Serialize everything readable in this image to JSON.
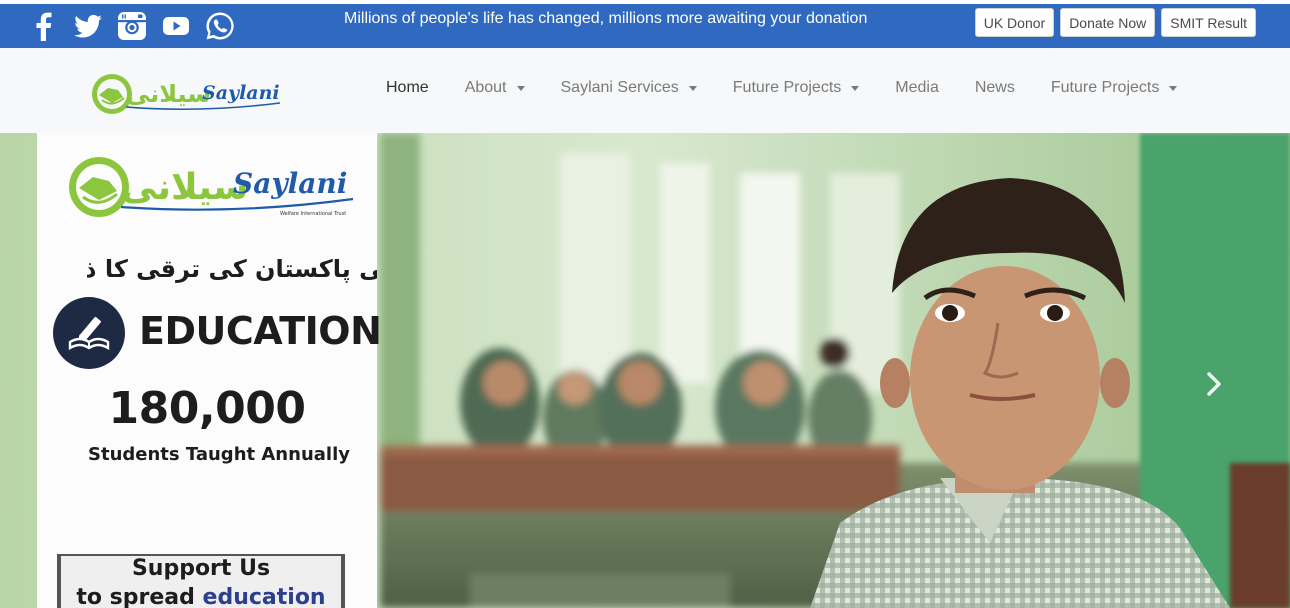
{
  "topbar": {
    "social": [
      "facebook-icon",
      "twitter-icon",
      "instagram-icon",
      "youtube-icon",
      "whatsapp-icon"
    ],
    "tagline": "Millions of people's life has changed, millions more awaiting your donation",
    "buttons": {
      "uk_donor": "UK Donor",
      "donate_now": "Donate Now",
      "smit_result": "SMIT Result"
    },
    "bg_color": "#2f6ac0"
  },
  "navbar": {
    "logo": {
      "urdu": "سیلانی",
      "latin": "Saylani"
    },
    "items": [
      {
        "label": "Home",
        "dropdown": false,
        "active": true
      },
      {
        "label": "About",
        "dropdown": true
      },
      {
        "label": "Saylani Services",
        "dropdown": true
      },
      {
        "label": "Future Projects",
        "dropdown": true
      },
      {
        "label": "Media",
        "dropdown": false
      },
      {
        "label": "News",
        "dropdown": false
      },
      {
        "label": "Future Projects",
        "dropdown": true
      }
    ]
  },
  "hero": {
    "panel": {
      "logo": {
        "urdu": "سیلانی",
        "latin": "Saylani",
        "sub": "Welfare International Trust"
      },
      "urdu_tagline": "تعلیم ہی پاکستان کی ترقی کا ذریعہ ہے",
      "education": "EDUCATION",
      "count": "180,000",
      "count_label": "Students Taught Annually",
      "support_line1": "Support Us",
      "support_line2_pre": "to spread",
      "support_line2_hl": "education"
    },
    "next_icon": "chevron-right-icon",
    "colors": {
      "brand_green": "#8cc63f",
      "brand_blue": "#1f5ba8"
    }
  }
}
